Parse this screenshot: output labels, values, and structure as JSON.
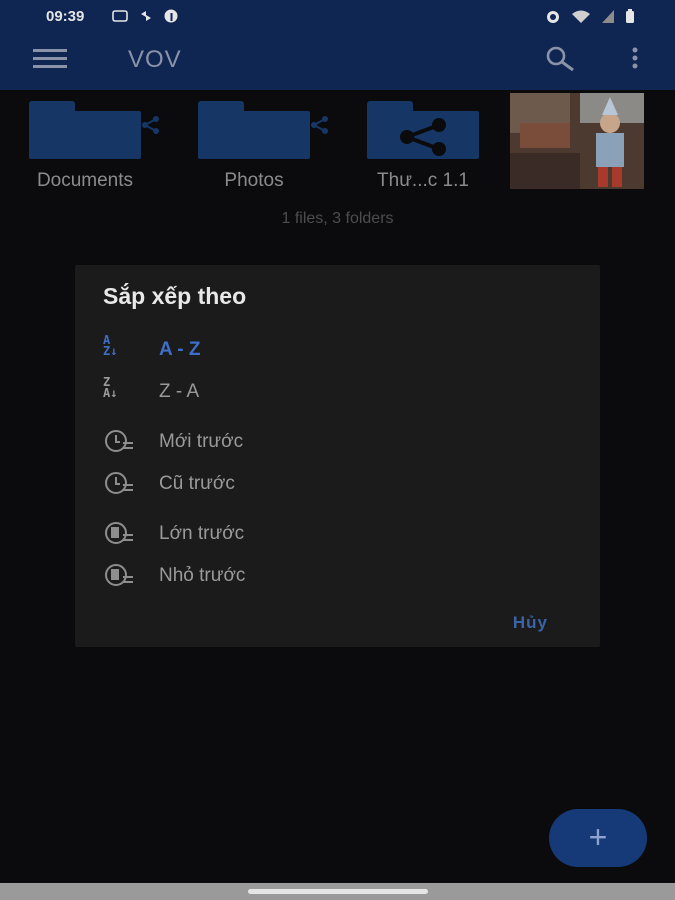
{
  "status": {
    "time": "09:39",
    "left_icons": [
      "sim-icon",
      "sync-icon",
      "facebook-icon"
    ],
    "right_icons": [
      "alarm-icon",
      "wifi-icon",
      "signal-icon",
      "battery-icon"
    ]
  },
  "appbar": {
    "title": "VOV",
    "menu_icon": "hamburger-menu-icon",
    "search_icon": "search-icon",
    "more_icon": "more-vert-icon"
  },
  "items": [
    {
      "label": "Documents",
      "type": "folder",
      "shared": true
    },
    {
      "label": "Photos",
      "type": "folder",
      "shared": true
    },
    {
      "label": "Thư...c 1.1",
      "type": "folder-shared",
      "shared": true
    },
    {
      "label": "",
      "type": "image"
    }
  ],
  "summary": "1 files, 3 folders",
  "dialog": {
    "title": "Sắp xếp theo",
    "options": [
      {
        "label": "A - Z",
        "icon": "sort-az-icon",
        "selected": true
      },
      {
        "label": "Z - A",
        "icon": "sort-za-icon",
        "selected": false
      },
      {
        "label": "Mới trước",
        "icon": "clock-newest-icon",
        "selected": false
      },
      {
        "label": "Cũ trước",
        "icon": "clock-oldest-icon",
        "selected": false
      },
      {
        "label": "Lớn trước",
        "icon": "size-largest-icon",
        "selected": false
      },
      {
        "label": "Nhỏ trước",
        "icon": "size-smallest-icon",
        "selected": false
      }
    ],
    "cancel": "Hủy"
  },
  "fab": {
    "icon": "plus-icon",
    "symbol": "+"
  },
  "colors": {
    "appbar": "#0f2552",
    "folder": "#163766",
    "accent": "#3d6fc8",
    "dialog_bg": "#1b1b1c"
  }
}
